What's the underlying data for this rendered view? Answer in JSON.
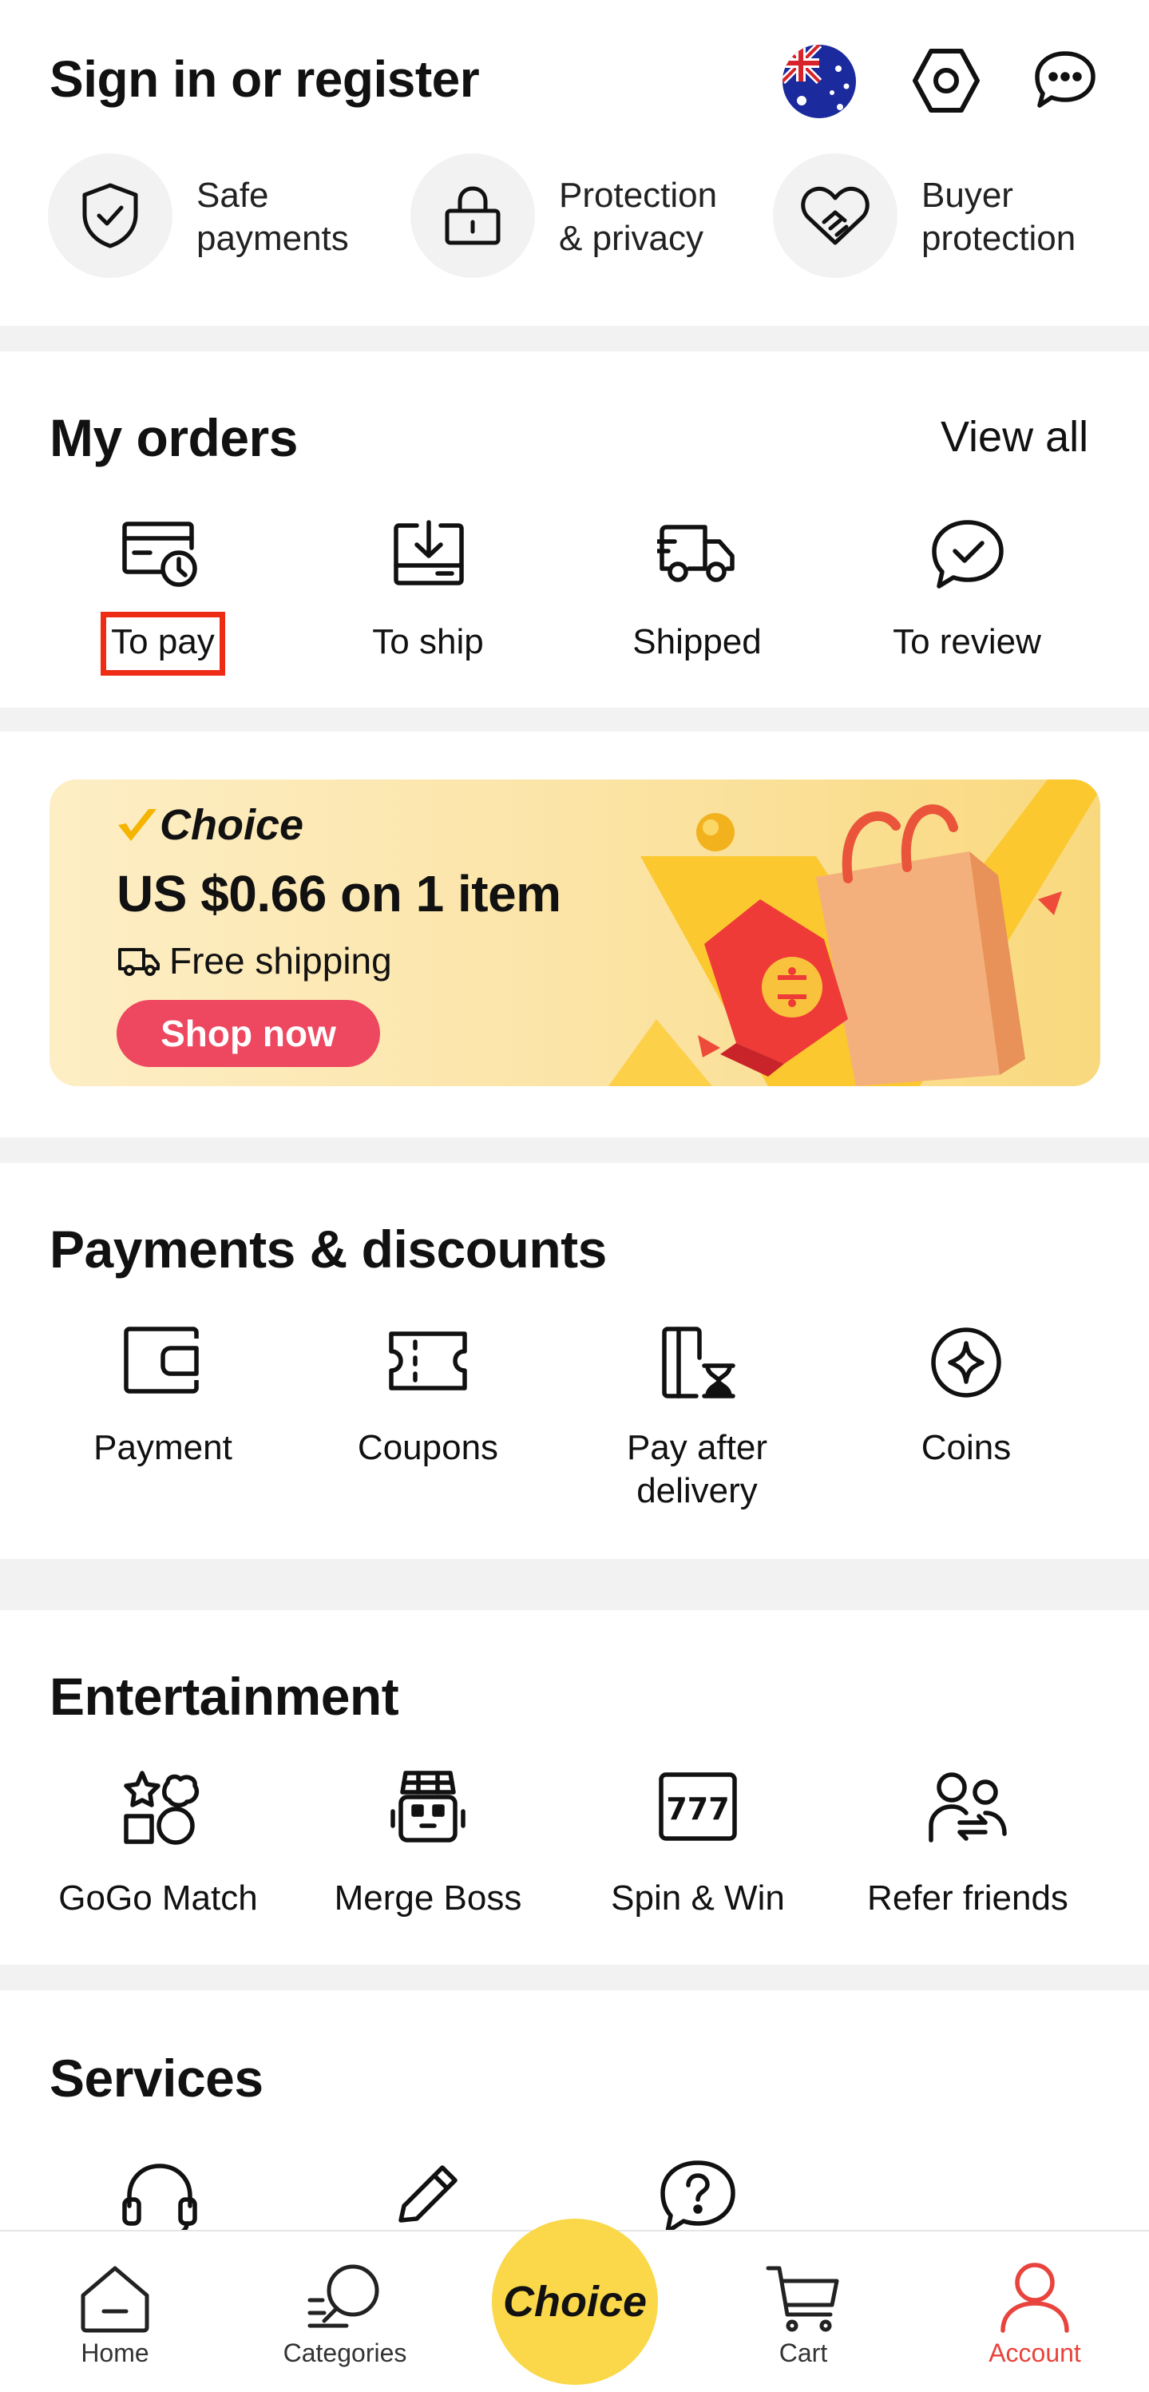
{
  "header": {
    "title": "Sign in or register",
    "icons": [
      "australia-flag-icon",
      "settings-hexagon-icon",
      "messages-icon"
    ]
  },
  "trust_badges": [
    {
      "line1": "Safe",
      "line2": "payments",
      "icon": "shield-check-icon"
    },
    {
      "line1": "Protection",
      "line2": "& privacy",
      "icon": "lock-icon"
    },
    {
      "line1": "Buyer",
      "line2": "protection",
      "icon": "handshake-heart-icon"
    }
  ],
  "orders": {
    "title": "My orders",
    "view_all": "View all",
    "items": [
      {
        "label": "To pay",
        "icon": "card-clock-icon"
      },
      {
        "label": "To ship",
        "icon": "box-download-icon"
      },
      {
        "label": "Shipped",
        "icon": "truck-icon"
      },
      {
        "label": "To review",
        "icon": "chat-check-icon"
      }
    ]
  },
  "banner": {
    "brand": "Choice",
    "headline": "US $0.66 on 1 item",
    "subline": "Free shipping",
    "cta": "Shop now",
    "colors": {
      "bg": "#fbe2a0",
      "cta": "#ee4760",
      "check": "#f4b400"
    }
  },
  "payments": {
    "title": "Payments & discounts",
    "items": [
      {
        "label": "Payment",
        "icon": "wallet-icon"
      },
      {
        "label": "Coupons",
        "icon": "ticket-icon"
      },
      {
        "label_line1": "Pay after",
        "label_line2": "delivery",
        "icon": "card-hourglass-icon"
      },
      {
        "label": "Coins",
        "icon": "coin-star-icon"
      }
    ]
  },
  "entertainment": {
    "title": "Entertainment",
    "items": [
      {
        "label": "GoGo Match",
        "icon": "shapes-match-icon"
      },
      {
        "label": "Merge Boss",
        "icon": "robot-icon"
      },
      {
        "label": "Spin & Win",
        "icon": "slot-777-icon"
      },
      {
        "label": "Refer friends",
        "icon": "people-refer-icon"
      }
    ]
  },
  "services": {
    "title": "Services",
    "icons": [
      "headset-icon",
      "pencil-icon",
      "help-bubble-icon"
    ]
  },
  "tabbar": {
    "items": [
      {
        "label": "Home",
        "icon": "home-icon"
      },
      {
        "label": "Categories",
        "icon": "categories-search-icon"
      },
      {
        "label": "Choice",
        "icon": "choice-badge"
      },
      {
        "label": "Cart",
        "icon": "cart-icon"
      },
      {
        "label": "Account",
        "icon": "account-icon"
      }
    ],
    "active": "Account",
    "active_color": "#e8433c",
    "choice_color": "#fad84a"
  },
  "highlight_color": "#ee2b14"
}
